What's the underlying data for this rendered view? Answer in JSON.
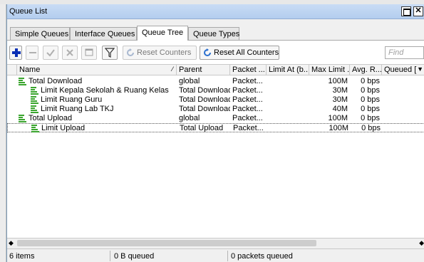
{
  "window": {
    "title": "Queue List"
  },
  "tabs": [
    {
      "label": "Simple Queues"
    },
    {
      "label": "Interface Queues"
    },
    {
      "label": "Queue Tree"
    },
    {
      "label": "Queue Types"
    }
  ],
  "toolbar": {
    "add_icon": "plus-icon",
    "remove_icon": "minus-icon",
    "enable_icon": "check-icon",
    "disable_icon": "x-icon",
    "comment_icon": "comment-icon",
    "filter_icon": "filter-icon",
    "reset_counters_label": "Reset Counters",
    "reset_all_counters_label": "Reset All Counters",
    "find_placeholder": "Find"
  },
  "table": {
    "columns": [
      "Name",
      "Parent",
      "Packet ...",
      "Limit At (b...",
      "Max Limit ...",
      "Avg. R...",
      "Queued ["
    ],
    "rows": [
      {
        "name": "Total Download",
        "parent": "global",
        "packet": "Packet...",
        "limit_at": "",
        "max_limit": "100M",
        "avg_rate": "0 bps",
        "indent": 0
      },
      {
        "name": "Limit Kepala Sekolah & Ruang Kelas",
        "parent": "Total Download",
        "packet": "Packet...",
        "limit_at": "",
        "max_limit": "30M",
        "avg_rate": "0 bps",
        "indent": 1
      },
      {
        "name": "Limit Ruang Guru",
        "parent": "Total Download",
        "packet": "Packet...",
        "limit_at": "",
        "max_limit": "30M",
        "avg_rate": "0 bps",
        "indent": 1
      },
      {
        "name": "Limit Ruang Lab TKJ",
        "parent": "Total Download",
        "packet": "Packet...",
        "limit_at": "",
        "max_limit": "40M",
        "avg_rate": "0 bps",
        "indent": 1
      },
      {
        "name": "Total Upload",
        "parent": "global",
        "packet": "Packet...",
        "limit_at": "",
        "max_limit": "100M",
        "avg_rate": "0 bps",
        "indent": 0
      },
      {
        "name": "Limit Upload",
        "parent": "Total Upload",
        "packet": "Packet...",
        "limit_at": "",
        "max_limit": "100M",
        "avg_rate": "0 bps",
        "indent": 1
      }
    ]
  },
  "status": {
    "items": "6 items",
    "queued": "0 B queued",
    "packets": "0 packets queued"
  },
  "colors": {
    "accent": "#3aa52e",
    "titlebar": "#c9dcf5",
    "add_button": "#0a2fb5"
  }
}
